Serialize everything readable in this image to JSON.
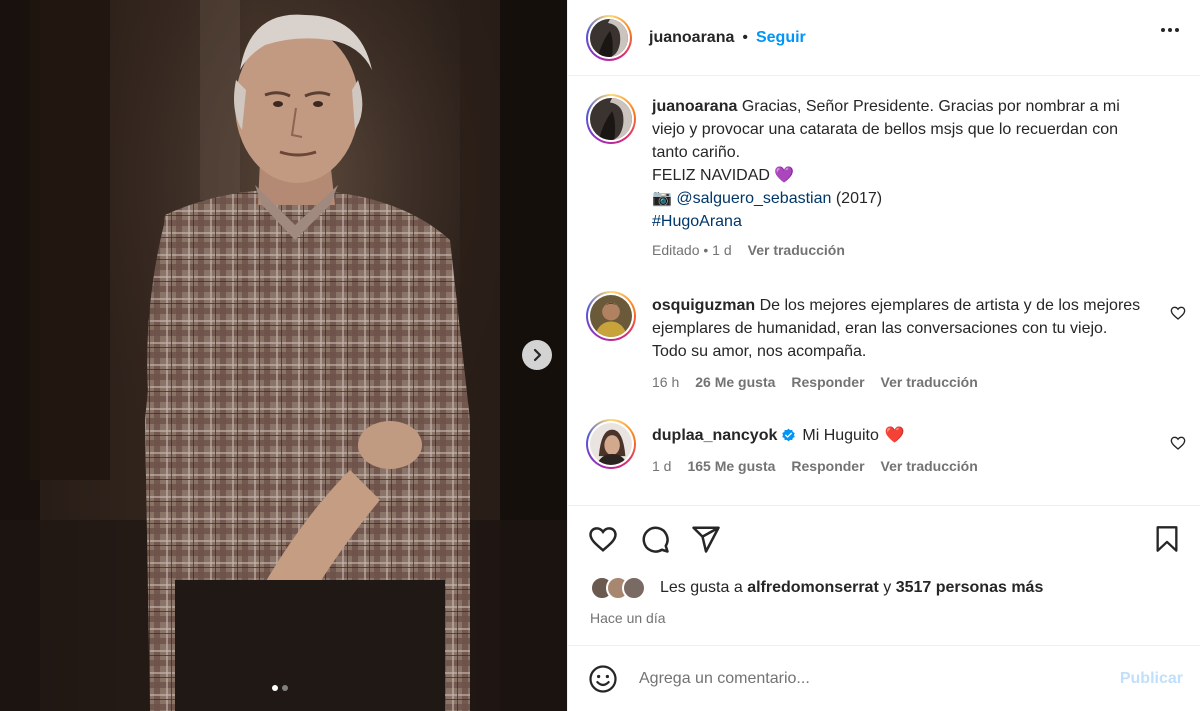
{
  "post": {
    "author": {
      "username": "juanoarana",
      "follow_label": "Seguir",
      "separator": "•"
    },
    "caption": {
      "username": "juanoarana",
      "line1": "Gracias, Señor Presidente. Gracias por nombrar a mi viejo y provocar una catarata de bellos msjs que lo recuerdan con tanto cariño.",
      "line2": "FELIZ NAVIDAD",
      "line2_emoji": "💜",
      "photo_emoji": "📷",
      "mention": "@salguero_sebastian",
      "year": "(2017)",
      "hashtag": "#HugoArana",
      "edited": "Editado • 1 d",
      "translate": "Ver traducción"
    },
    "comments": [
      {
        "username": "osquiguzman",
        "text": "De los mejores ejemplares de artista y de los mejores ejemplares de humanidad, eran las conversaciones con tu viejo. Todo su amor, nos acompaña.",
        "time": "16 h",
        "likes": "26 Me gusta",
        "reply": "Responder",
        "translate": "Ver traducción"
      },
      {
        "username": "duplaa_nancyok",
        "verified": true,
        "text": "Mi Huguito",
        "emoji": "❤️",
        "time": "1 d",
        "likes": "165 Me gusta",
        "reply": "Responder",
        "translate": "Ver traducción"
      }
    ],
    "likes_summary": {
      "prefix": "Les gusta a",
      "user": "alfredomonserrat",
      "middle": "y",
      "others": "3517 personas más"
    },
    "posted": "Hace un día",
    "add_comment": {
      "placeholder": "Agrega un comentario...",
      "publish": "Publicar"
    },
    "carousel": {
      "count": 2,
      "active": 1
    }
  },
  "colors": {
    "accent": "#0095f6",
    "publish_disabled": "#c0dffd",
    "heart_purple": "#8a62e0",
    "heart_red": "#e0245e",
    "verified": "#0095f6"
  },
  "icons": [
    "chevron-right-icon",
    "more-icon",
    "heart-icon",
    "comment-icon",
    "share-icon",
    "bookmark-icon",
    "emoji-icon",
    "verified-icon",
    "camera-icon"
  ]
}
